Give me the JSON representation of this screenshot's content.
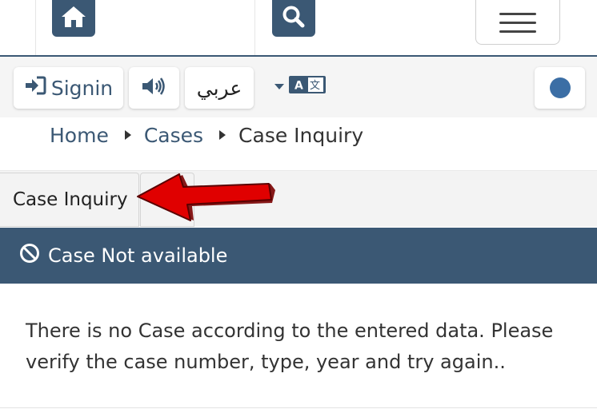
{
  "toolbar": {
    "signin_label": "Signin",
    "arabic_label": "عربي",
    "lang_badge": "A 文"
  },
  "icons": {
    "home": "home-icon",
    "search": "search-icon",
    "menu": "hamburger-icon",
    "signin": "sign-in-icon",
    "sound": "speaker-icon",
    "language": "translate-icon",
    "contrast": "circle-icon",
    "alert": "ban-icon"
  },
  "breadcrumb": {
    "home": "Home",
    "cases": "Cases",
    "current": "Case Inquiry"
  },
  "tabs": {
    "case_inquiry": "Case Inquiry"
  },
  "alert": {
    "title": "Case Not available"
  },
  "message": {
    "text": "There is no Case according to the entered data. Please verify the case number, type, year and try again.."
  },
  "colors": {
    "primary": "#3b5874",
    "annotation_arrow": "#e00000"
  }
}
